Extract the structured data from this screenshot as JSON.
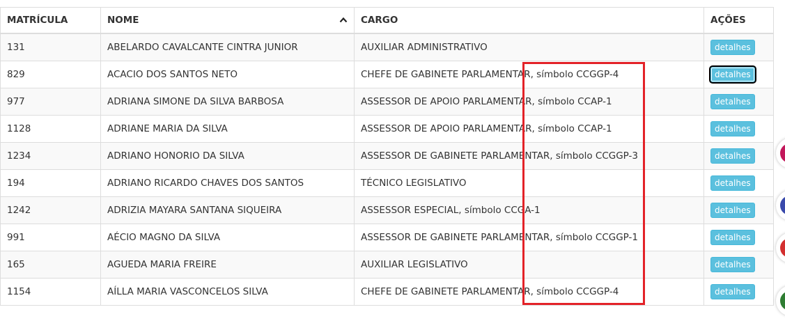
{
  "table": {
    "headers": {
      "matricula": "MATRÍCULA",
      "nome": "NOME",
      "cargo": "CARGO",
      "acoes": "AÇÕES"
    },
    "sort_icon": "chevron-up-icon",
    "rows": [
      {
        "matricula": "131",
        "nome": "ABELARDO CAVALCANTE CINTRA JUNIOR",
        "cargo": "AUXILIAR ADMINISTRATIVO",
        "acao": "detalhes"
      },
      {
        "matricula": "829",
        "nome": "ACACIO DOS SANTOS NETO",
        "cargo": "CHEFE DE GABINETE PARLAMENTAR, símbolo CCGGP-4",
        "acao": "detalhes"
      },
      {
        "matricula": "977",
        "nome": "ADRIANA SIMONE DA SILVA BARBOSA",
        "cargo": "ASSESSOR DE APOIO PARLAMENTAR, símbolo CCAP-1",
        "acao": "detalhes"
      },
      {
        "matricula": "1128",
        "nome": "ADRIANE MARIA DA SILVA",
        "cargo": "ASSESSOR DE APOIO PARLAMENTAR, símbolo CCAP-1",
        "acao": "detalhes"
      },
      {
        "matricula": "1234",
        "nome": "ADRIANO HONORIO DA SILVA",
        "cargo": "ASSESSOR DE GABINETE PARLAMENTAR, símbolo CCGGP-3",
        "acao": "detalhes"
      },
      {
        "matricula": "194",
        "nome": "ADRIANO RICARDO CHAVES DOS SANTOS",
        "cargo": "TÉCNICO LEGISLATIVO",
        "acao": "detalhes"
      },
      {
        "matricula": "1242",
        "nome": "ADRIZIA MAYARA SANTANA SIQUEIRA",
        "cargo": "ASSESSOR ESPECIAL, símbolo CCGA-1",
        "acao": "detalhes"
      },
      {
        "matricula": "991",
        "nome": "AÉCIO MAGNO DA SILVA",
        "cargo": "ASSESSOR DE GABINETE PARLAMENTAR, símbolo CCGGP-1",
        "acao": "detalhes"
      },
      {
        "matricula": "165",
        "nome": "AGUEDA MARIA FREIRE",
        "cargo": "AUXILIAR LEGISLATIVO",
        "acao": "detalhes"
      },
      {
        "matricula": "1154",
        "nome": "AÍLLA MARIA VASCONCELOS SILVA",
        "cargo": "CHEFE DE GABINETE PARLAMENTAR, símbolo CCGGP-4",
        "acao": "detalhes"
      }
    ]
  },
  "colors": {
    "button": "#5bc0de",
    "highlight": "#e32228",
    "side_buttons": [
      "#c2185b",
      "#3949ab",
      "#d32f2f",
      "#2e7d32"
    ]
  }
}
